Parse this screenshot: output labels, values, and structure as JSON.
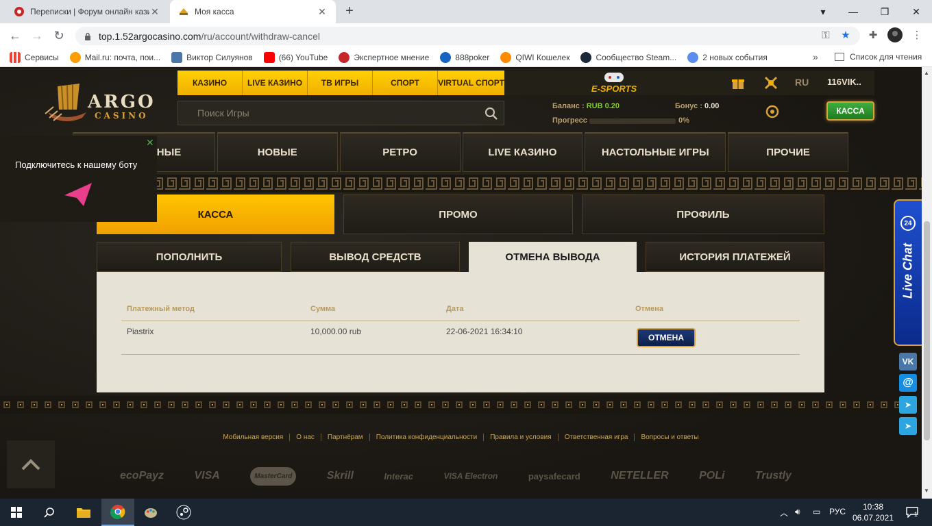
{
  "browser": {
    "tabs": [
      {
        "title": "Переписки | Форум онлайн казино",
        "active": false
      },
      {
        "title": "Моя касса",
        "active": true
      }
    ],
    "url_host": "top.1.52argocasino.com",
    "url_path": "/ru/account/withdraw-cancel",
    "bookmarks": [
      {
        "label": "Сервисы",
        "icon": "apps-grid-icon",
        "color": "#ea4335"
      },
      {
        "label": "Mail.ru: почта, пои...",
        "icon": "mailru-icon",
        "color": "#ff9e00"
      },
      {
        "label": "Виктор Силуянов",
        "icon": "vk-icon",
        "color": "#4a76a8"
      },
      {
        "label": "(66) YouTube",
        "icon": "youtube-icon",
        "color": "#ff0000"
      },
      {
        "label": "Экспертное мнение",
        "icon": "expert-icon",
        "color": "#c62828"
      },
      {
        "label": "888poker",
        "icon": "poker-icon",
        "color": "#1565c0"
      },
      {
        "label": "QIWI Кошелек",
        "icon": "qiwi-icon",
        "color": "#ff8c00"
      },
      {
        "label": "Сообщество Steam...",
        "icon": "steam-icon",
        "color": "#1b2838"
      },
      {
        "label": "2 новых события",
        "icon": "globe-icon",
        "color": "#5b8def"
      }
    ],
    "bookmarks_more": "»",
    "reading_list": "Список для чтения"
  },
  "site": {
    "logo_text": "ARGO",
    "logo_sub": "CASINO",
    "top_nav": [
      "КАЗИНО",
      "LIVE КАЗИНО",
      "ТВ ИГРЫ",
      "СПОРТ",
      "VIRTUAL СПОРТ"
    ],
    "esports_label": "E-SPORTS",
    "lang": "RU",
    "username": "116VIK..",
    "search_placeholder": "Поиск Игры",
    "balance_label": "Баланс :",
    "balance_value": "RUB 0.20",
    "bonus_label": "Бонус :",
    "bonus_value": "0.00",
    "progress_label": "Прогресс",
    "progress_pct": "0%",
    "progress_value": 0,
    "kassa_button": "КАССА",
    "categories": [
      "ПОПУЛЯРНЫЕ",
      "НОВЫЕ",
      "РЕТРО",
      "LIVE КАЗИНО",
      "НАСТОЛЬНЫЕ ИГРЫ",
      "ПРОЧИЕ"
    ],
    "bot_popup_text": "Подключитесь к нашему боту",
    "bot_close": "✕",
    "main_tabs": [
      "КАССА",
      "ПРОМО",
      "ПРОФИЛЬ"
    ],
    "sub_tabs": [
      "ПОПОЛНИТЬ",
      "ВЫВОД СРЕДСТВ",
      "ОТМЕНА ВЫВОДА",
      "ИСТОРИЯ ПЛАТЕЖЕЙ"
    ],
    "table": {
      "headers": [
        "Платежный метод",
        "Сумма",
        "Дата",
        "Отмена"
      ],
      "rows": [
        {
          "method": "Piastrix",
          "amount": "10,000.00 rub",
          "date": "22-06-2021 16:34:10",
          "action": "ОТМЕНА"
        }
      ]
    },
    "footer_links": [
      "Мобильная версия",
      "О нас",
      "Партнёрам",
      "Политика конфиденциальности",
      "Правила и условия",
      "Ответственная игра",
      "Вопросы и ответы"
    ],
    "payments": [
      "ecoPayz",
      "VISA",
      "MasterCard",
      "Skrill",
      "Interac",
      "VISA Electron",
      "paysafecard",
      "NETELLER",
      "POLi",
      "Trustly"
    ],
    "live_chat": "Live Chat",
    "live_chat_badge": "24",
    "social": [
      {
        "name": "vk",
        "label": "VK",
        "color": "#4a76a8"
      },
      {
        "name": "mail",
        "label": "@",
        "color": "#168de2"
      },
      {
        "name": "telegram",
        "label": "➤",
        "color": "#2ca5e0"
      },
      {
        "name": "telegram2",
        "label": "➤",
        "color": "#2ca5e0"
      }
    ],
    "colors": {
      "accent_yellow": "#ffc400",
      "gold_border": "#d9a23a",
      "green": "#7ed321"
    }
  },
  "taskbar": {
    "lang": "РУС",
    "time": "10:38",
    "date": "06.07.2021",
    "notifications": "1"
  }
}
